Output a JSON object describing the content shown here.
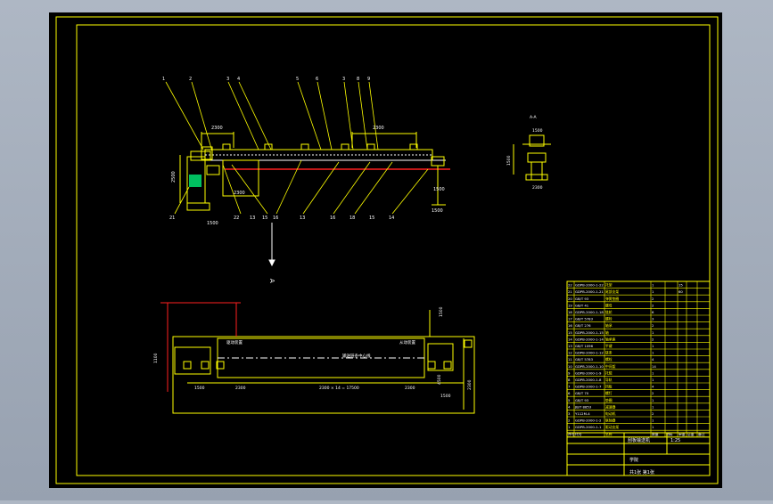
{
  "view_label": "A",
  "section_label": "A-A",
  "elevation": {
    "part_numbers": [
      "1",
      "2",
      "3",
      "4",
      "5",
      "6",
      "3",
      "8",
      "9"
    ],
    "bottom_numbers": [
      "21",
      "22",
      "13",
      "15",
      "16",
      "13",
      "16",
      "18",
      "15",
      "14"
    ],
    "dims": {
      "top_span": "2300",
      "top_right": "2300",
      "left_height": "2500",
      "left_width": "1500",
      "sub_width": "2300",
      "right_height": "1500",
      "right_bottom": "1500"
    }
  },
  "plan": {
    "tags_left": [
      "1100",
      "1500"
    ],
    "mid_span": "2300 × 14 = 17500",
    "left_span": "2300",
    "right_span": "2300",
    "right_dims": [
      "1500",
      "2300",
      "4500",
      "1500"
    ],
    "labels": [
      "驱动装置",
      "从动装置"
    ],
    "center_note": "输送链条中心线"
  },
  "section": {
    "dims": [
      "1500",
      "1500",
      "2300"
    ]
  },
  "bom": {
    "rows": [
      {
        "no": "22",
        "code": "GDPB-2000-1-22",
        "name": "托架",
        "qty": "1",
        "mat": "",
        "wt": "15",
        "note": ""
      },
      {
        "no": "21",
        "code": "GDPB-2000-1-21",
        "name": "尾部支架",
        "qty": "1",
        "mat": "",
        "wt": "60",
        "note": ""
      },
      {
        "no": "20",
        "code": "GB/T 93",
        "name": "弹簧垫圈",
        "qty": "2",
        "mat": "",
        "wt": "",
        "note": ""
      },
      {
        "no": "19",
        "code": "GB/T 41",
        "name": "螺母",
        "qty": "2",
        "mat": "",
        "wt": "",
        "note": ""
      },
      {
        "no": "18",
        "code": "GDPB-2000-1-18",
        "name": "链轮",
        "qty": "6",
        "mat": "",
        "wt": "",
        "note": ""
      },
      {
        "no": "17",
        "code": "GB/T 5783",
        "name": "螺栓",
        "qty": "3",
        "mat": "",
        "wt": "",
        "note": ""
      },
      {
        "no": "16",
        "code": "GB/T 276",
        "name": "轴承",
        "qty": "2",
        "mat": "",
        "wt": "",
        "note": ""
      },
      {
        "no": "15",
        "code": "GDPB-2000-1-15",
        "name": "轴",
        "qty": "1",
        "mat": "",
        "wt": "",
        "note": ""
      },
      {
        "no": "14",
        "code": "GDPB-2000-1-14",
        "name": "轴承座",
        "qty": "2",
        "mat": "",
        "wt": "",
        "note": ""
      },
      {
        "no": "13",
        "code": "GB/T 1096",
        "name": "平键",
        "qty": "1",
        "mat": "",
        "wt": "",
        "note": ""
      },
      {
        "no": "12",
        "code": "GDPB-2000-1-12",
        "name": "链条",
        "qty": "1",
        "mat": "",
        "wt": "",
        "note": ""
      },
      {
        "no": "11",
        "code": "GB/T 5783",
        "name": "螺栓",
        "qty": "4",
        "mat": "",
        "wt": "",
        "note": ""
      },
      {
        "no": "10",
        "code": "GDPB-2000-1-10",
        "name": "中间架",
        "qty": "14",
        "mat": "",
        "wt": "",
        "note": ""
      },
      {
        "no": "9",
        "code": "GDPB-2000-1-9",
        "name": "托辊",
        "qty": "1",
        "mat": "",
        "wt": "",
        "note": ""
      },
      {
        "no": "8",
        "code": "GDPB-2000-1-8",
        "name": "导轨",
        "qty": "1",
        "mat": "",
        "wt": "",
        "note": ""
      },
      {
        "no": "7",
        "code": "GDPB-2000-1-7",
        "name": "挡板",
        "qty": "4",
        "mat": "",
        "wt": "",
        "note": ""
      },
      {
        "no": "6",
        "code": "GB/T 70",
        "name": "螺钉",
        "qty": "2",
        "mat": "",
        "wt": "",
        "note": ""
      },
      {
        "no": "5",
        "code": "GB/T 93",
        "name": "垫圈",
        "qty": "1",
        "mat": "",
        "wt": "",
        "note": ""
      },
      {
        "no": "4",
        "code": "JB/T 8853",
        "name": "减速器",
        "qty": "1",
        "mat": "",
        "wt": "",
        "note": ""
      },
      {
        "no": "3",
        "code": "Y112M-4",
        "name": "电动机",
        "qty": "2",
        "mat": "",
        "wt": "",
        "note": ""
      },
      {
        "no": "2",
        "code": "GDPB-2000-1-2",
        "name": "联轴器",
        "qty": "1",
        "mat": "",
        "wt": "",
        "note": ""
      },
      {
        "no": "1",
        "code": "GDPB-2000-1-1",
        "name": "驱动支架",
        "qty": "1",
        "mat": "",
        "wt": "",
        "note": ""
      }
    ],
    "header": [
      "序号",
      "代号",
      "名称",
      "数量",
      "材料",
      "单重",
      "总重",
      "备注"
    ]
  },
  "title_block": {
    "drawing_name": "刮板输送机",
    "sheet": "共1张 第1张",
    "scale": "1:25",
    "unit": "学院"
  },
  "colors": {
    "line": "#ffff00",
    "annotation": "#ffffff",
    "red": "#ff2020",
    "green": "#00c060",
    "frame_bg": "#000000"
  }
}
